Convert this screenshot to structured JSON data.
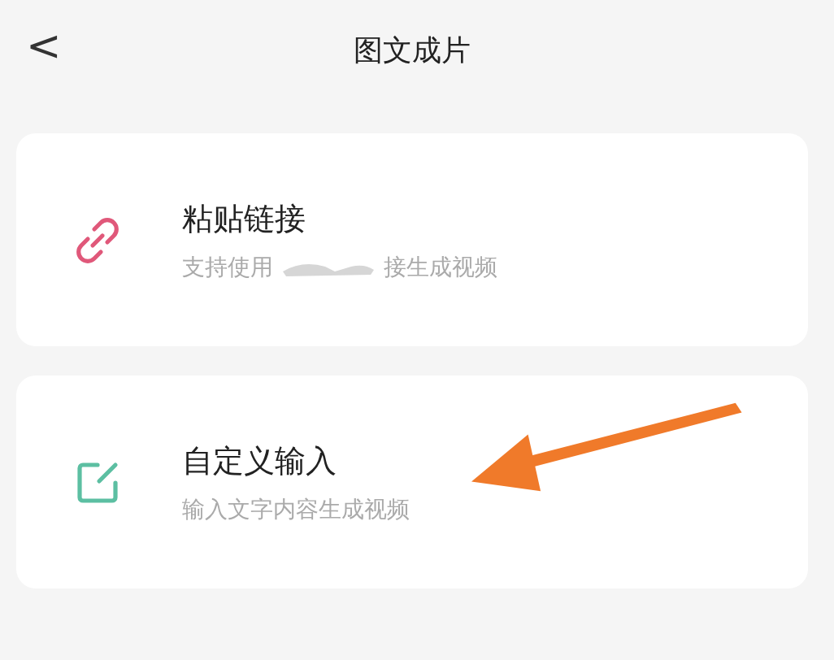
{
  "header": {
    "back": "<",
    "title": "图文成片"
  },
  "options": [
    {
      "kind": "link",
      "color": "#e0587a",
      "title": "粘贴链接",
      "subtitle_parts": [
        "支持使用",
        "接生成视频"
      ],
      "redacted": true
    },
    {
      "kind": "edit",
      "color": "#5cbfa2",
      "title": "自定义输入",
      "subtitle_parts": [
        "输入文字内容生成视频"
      ],
      "redacted": false
    }
  ],
  "annotation": {
    "kind": "arrow",
    "color": "#f07a2a"
  }
}
